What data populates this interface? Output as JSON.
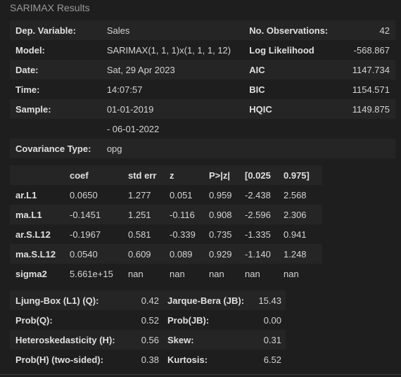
{
  "caption": "SARIMAX Results",
  "summary": [
    [
      "Dep. Variable:",
      "Sales",
      "No. Observations:",
      "42"
    ],
    [
      "Model:",
      "SARIMAX(1, 1, 1)x(1, 1, 1, 12)",
      "Log Likelihood",
      "-568.867"
    ],
    [
      "Date:",
      "Sat, 29 Apr 2023",
      "AIC",
      "1147.734"
    ],
    [
      "Time:",
      "14:07:57",
      "BIC",
      "1154.571"
    ],
    [
      "Sample:",
      "01-01-2019",
      "HQIC",
      "1149.875"
    ],
    [
      "",
      "- 06-01-2022",
      "",
      ""
    ],
    [
      "Covariance Type:",
      "opg",
      "",
      ""
    ]
  ],
  "coef_table": {
    "headers": [
      "",
      "coef",
      "std err",
      "z",
      "P>|z|",
      "[0.025",
      "0.975]"
    ],
    "rows": [
      [
        "ar.L1",
        "0.0650",
        "1.277",
        "0.051",
        "0.959",
        "-2.438",
        "2.568"
      ],
      [
        "ma.L1",
        "-0.1451",
        "1.251",
        "-0.116",
        "0.908",
        "-2.596",
        "2.306"
      ],
      [
        "ar.S.L12",
        "-0.1967",
        "0.581",
        "-0.339",
        "0.735",
        "-1.335",
        "0.941"
      ],
      [
        "ma.S.L12",
        "0.0540",
        "0.609",
        "0.089",
        "0.929",
        "-1.140",
        "1.248"
      ],
      [
        "sigma2",
        "5.661e+15",
        "nan",
        "nan",
        "nan",
        "nan",
        "nan"
      ]
    ]
  },
  "diagnostics": [
    [
      "Ljung-Box (L1) (Q):",
      "0.42",
      "Jarque-Bera (JB):",
      "15.43"
    ],
    [
      "Prob(Q):",
      "0.52",
      "Prob(JB):",
      "0.00"
    ],
    [
      "Heteroskedasticity (H):",
      "0.56",
      "Skew:",
      "0.31"
    ],
    [
      "Prob(H) (two-sided):",
      "0.38",
      "Kurtosis:",
      "6.52"
    ]
  ]
}
